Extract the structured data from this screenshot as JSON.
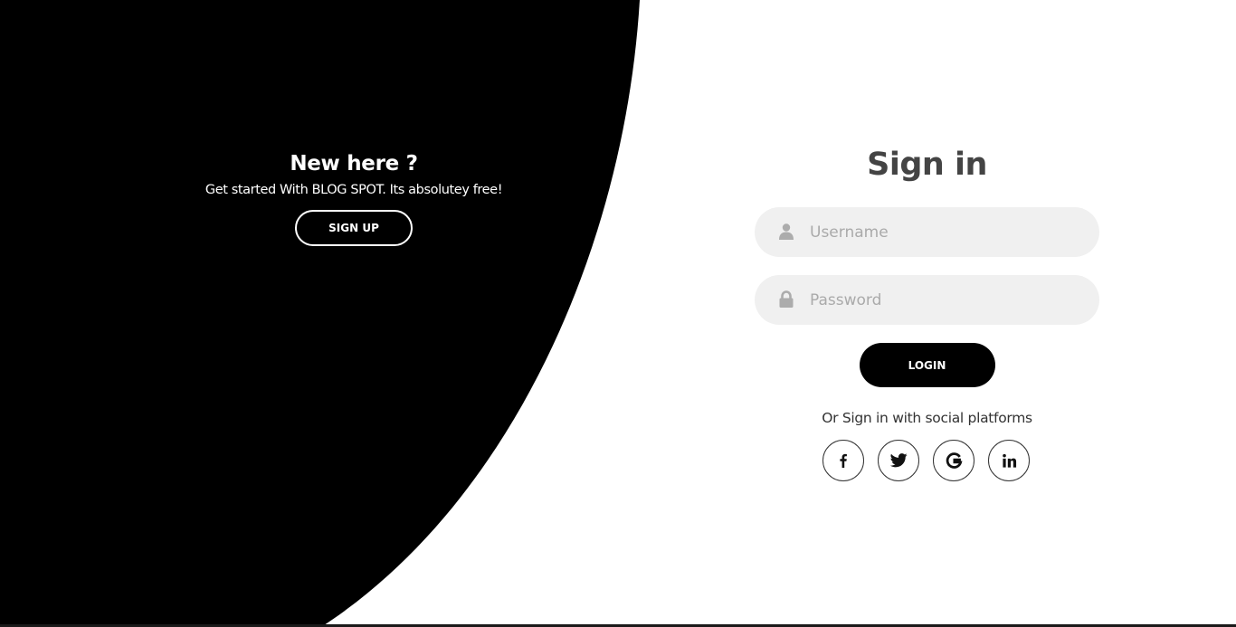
{
  "colors": {
    "panel_background": "#000000",
    "page_background": "#ffffff",
    "input_background": "#f0f0f0",
    "title_color": "#444444",
    "placeholder_color": "#aaaaaa"
  },
  "left_panel": {
    "title": "New here ?",
    "subtitle": "Get started With BLOG SPOT. Its absolutey free!",
    "signup_label": "SIGN UP"
  },
  "signin_form": {
    "title": "Sign in",
    "username": {
      "placeholder": "Username",
      "value": "",
      "icon": "user-icon"
    },
    "password": {
      "placeholder": "Password",
      "value": "",
      "icon": "lock-icon"
    },
    "login_label": "LOGIN",
    "social_text": "Or Sign in with social platforms",
    "social_platforms": [
      {
        "name": "facebook",
        "icon": "facebook-icon"
      },
      {
        "name": "twitter",
        "icon": "twitter-icon"
      },
      {
        "name": "google",
        "icon": "google-icon"
      },
      {
        "name": "linkedin",
        "icon": "linkedin-icon"
      }
    ]
  }
}
